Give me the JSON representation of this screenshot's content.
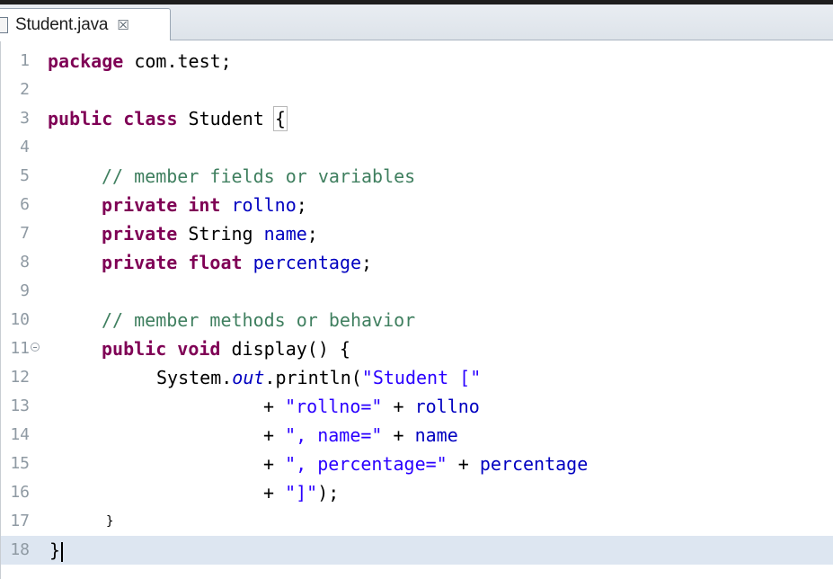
{
  "tab": {
    "filename": "Student.java",
    "close_glyph": "☒"
  },
  "line_numbers": [
    "1",
    "2",
    "3",
    "4",
    "5",
    "6",
    "7",
    "8",
    "9",
    "10",
    "11",
    "12",
    "13",
    "14",
    "15",
    "16",
    "17",
    "18"
  ],
  "code": {
    "l1_kw": "package",
    "l1_rest": " com.test;",
    "l3_kw1": "public",
    "l3_kw2": "class",
    "l3_rest": " Student ",
    "l3_brace": "{",
    "l5_comment": "// member fields or variables",
    "l6_kw1": "private",
    "l6_kw2": "int",
    "l6_field": "rollno",
    "l6_end": ";",
    "l7_kw": "private",
    "l7_type": " String ",
    "l7_field": "name",
    "l7_end": ";",
    "l8_kw1": "private",
    "l8_kw2": "float",
    "l8_field": "percentage",
    "l8_end": ";",
    "l10_comment": "// member methods or behavior",
    "l11_kw1": "public",
    "l11_kw2": "void",
    "l11_rest": " display() {",
    "l12_a": "System.",
    "l12_out": "out",
    "l12_b": ".println(",
    "l12_str": "\"Student [\"",
    "l13_a": "+ ",
    "l13_str": "\"rollno=\"",
    "l13_b": " + ",
    "l13_field": "rollno",
    "l14_a": "+ ",
    "l14_str": "\", name=\"",
    "l14_b": " + ",
    "l14_field": "name",
    "l15_a": "+ ",
    "l15_str": "\", percentage=\"",
    "l15_b": " + ",
    "l15_field": "percentage",
    "l16_a": "+ ",
    "l16_str": "\"]\"",
    "l16_b": ");",
    "l17_brace": "}",
    "l18_brace": "}"
  },
  "colors": {
    "keyword": "#7f0055",
    "comment": "#3f7f5f",
    "field": "#0000c0",
    "string": "#2a00ff",
    "current_line": "#dde6f1"
  },
  "icons": {
    "file": "java-file-icon",
    "close": "close-tab-icon",
    "fold": "collapse-fold-icon"
  }
}
